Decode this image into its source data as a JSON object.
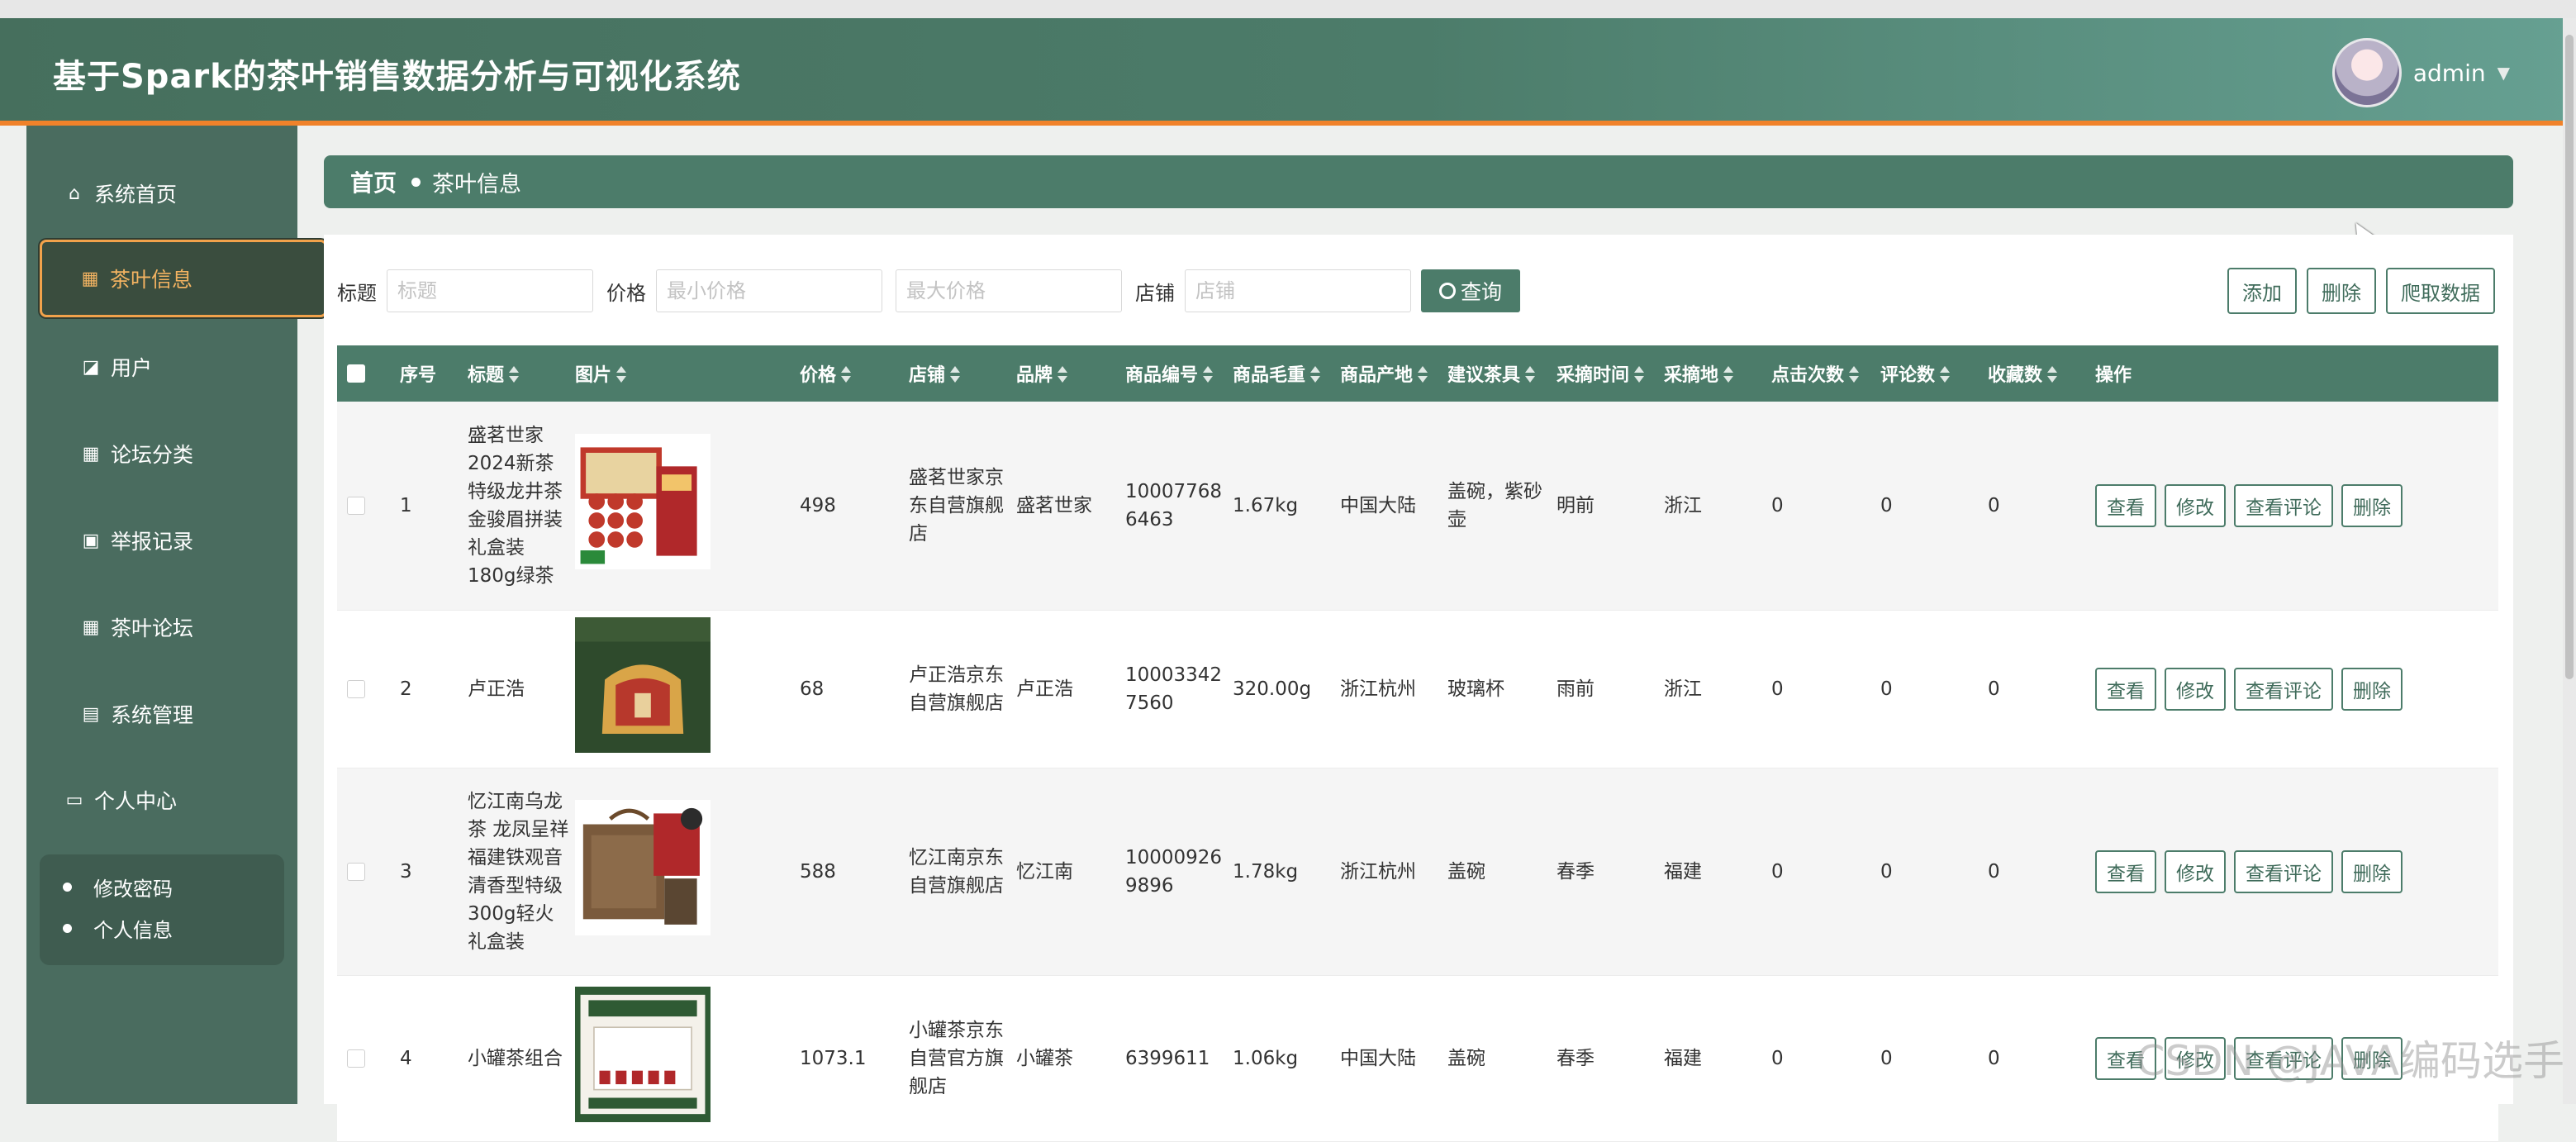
{
  "header": {
    "title": "基于Spark的茶叶销售数据分析与可视化系统",
    "user": "admin"
  },
  "sidebar": {
    "items": [
      {
        "label": "系统首页",
        "icon": "home-icon"
      },
      {
        "label": "茶叶信息",
        "icon": "grid-icon",
        "active": true
      },
      {
        "label": "用户",
        "icon": "chart-icon"
      },
      {
        "label": "论坛分类",
        "icon": "grid-icon"
      },
      {
        "label": "举报记录",
        "icon": "report-icon"
      },
      {
        "label": "茶叶论坛",
        "icon": "grid-icon"
      },
      {
        "label": "系统管理",
        "icon": "chat-icon"
      },
      {
        "label": "个人中心",
        "icon": "card-icon"
      }
    ],
    "submenu": [
      "修改密码",
      "个人信息"
    ]
  },
  "breadcrumb": {
    "home": "首页",
    "current": "茶叶信息"
  },
  "search": {
    "title_label": "标题",
    "title_placeholder": "标题",
    "price_label": "价格",
    "min_price_placeholder": "最小价格",
    "max_price_placeholder": "最大价格",
    "shop_label": "店铺",
    "shop_placeholder": "店铺",
    "query_button": "查询"
  },
  "actions": {
    "add": "添加",
    "delete": "删除",
    "crawl": "爬取数据"
  },
  "table": {
    "columns": [
      "序号",
      "标题",
      "图片",
      "价格",
      "店铺",
      "品牌",
      "商品编号",
      "商品毛重",
      "商品产地",
      "建议茶具",
      "采摘时间",
      "采摘地",
      "点击次数",
      "评论数",
      "收藏数",
      "操作"
    ],
    "row_actions": [
      "查看",
      "修改",
      "查看评论",
      "删除"
    ],
    "rows": [
      {
        "no": "1",
        "title": "盛茗世家 2024新茶 特级龙井茶金骏眉拼装礼盒装180g绿茶",
        "image": "tea-gift-box-red",
        "price": "498",
        "shop": "盛茗世家京东自营旗舰店",
        "brand": "盛茗世家",
        "code": "100077686463",
        "weight": "1.67kg",
        "origin": "中国大陆",
        "teaware": "盖碗，紫砂壶",
        "pick_time": "明前",
        "pick_place": "浙江",
        "clicks": "0",
        "comments": "0",
        "favorites": "0"
      },
      {
        "no": "2",
        "title": "卢正浩",
        "image": "tea-bundle-green",
        "price": "68",
        "shop": "卢正浩京东自营旗舰店",
        "brand": "卢正浩",
        "code": "100033427560",
        "weight": "320.00g",
        "origin": "浙江杭州",
        "teaware": "玻璃杯",
        "pick_time": "雨前",
        "pick_place": "浙江",
        "clicks": "0",
        "comments": "0",
        "favorites": "0"
      },
      {
        "no": "3",
        "title": "忆江南乌龙茶 龙凤呈祥福建铁观音清香型特级300g轻火礼盒装",
        "image": "tea-gift-box-brown",
        "price": "588",
        "shop": "忆江南京东自营旗舰店",
        "brand": "忆江南",
        "code": "100009269896",
        "weight": "1.78kg",
        "origin": "浙江杭州",
        "teaware": "盖碗",
        "pick_time": "春季",
        "pick_place": "福建",
        "clicks": "0",
        "comments": "0",
        "favorites": "0"
      },
      {
        "no": "4",
        "title": "小罐茶组合",
        "image": "tea-gift-box-white",
        "price": "1073.1",
        "shop": "小罐茶京东自营官方旗舰店",
        "brand": "小罐茶",
        "code": "6399611",
        "weight": "1.06kg",
        "origin": "中国大陆",
        "teaware": "盖碗",
        "pick_time": "春季",
        "pick_place": "福建",
        "clicks": "0",
        "comments": "0",
        "favorites": "0"
      }
    ]
  },
  "colors": {
    "primary": "#4c7c6a",
    "accent": "#f0822a",
    "sidebar": "#4a6c5f"
  },
  "watermark": "CSDN @JAVA编码选手"
}
